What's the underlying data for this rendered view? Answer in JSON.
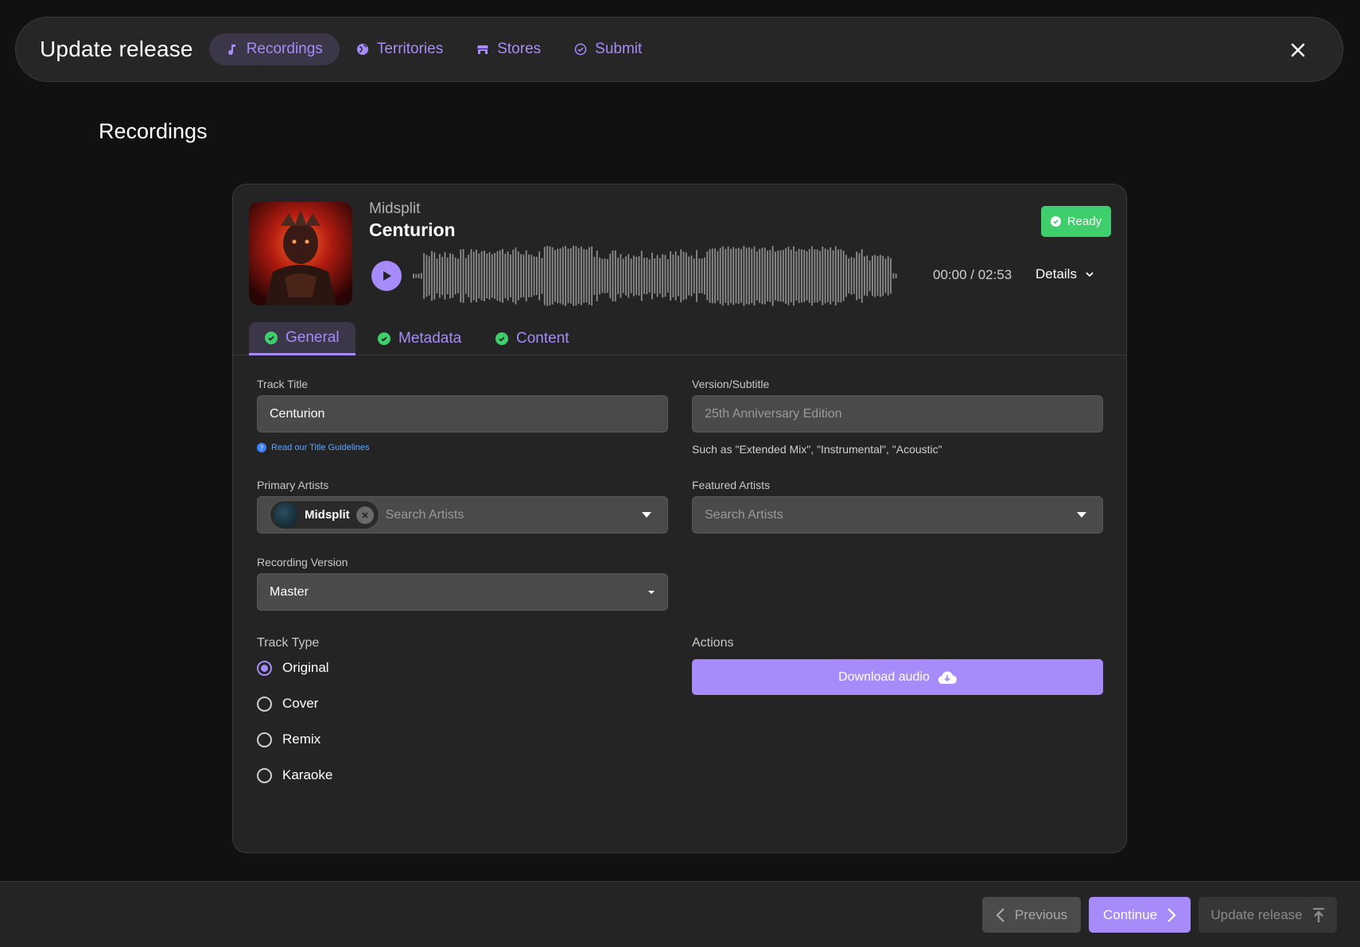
{
  "header": {
    "title": "Update release",
    "tabs": [
      {
        "label": "Recordings",
        "icon": "music-note-icon",
        "active": true
      },
      {
        "label": "Territories",
        "icon": "globe-icon",
        "active": false
      },
      {
        "label": "Stores",
        "icon": "store-icon",
        "active": false
      },
      {
        "label": "Submit",
        "icon": "check-circle-icon",
        "active": false
      }
    ]
  },
  "page_title": "Recordings",
  "recording": {
    "artist": "Midsplit",
    "title": "Centurion",
    "status": "Ready",
    "time": "00:00 / 02:53",
    "details_label": "Details",
    "tabs": [
      {
        "label": "General",
        "active": true
      },
      {
        "label": "Metadata",
        "active": false
      },
      {
        "label": "Content",
        "active": false
      }
    ]
  },
  "form": {
    "track_title_label": "Track Title",
    "track_title_value": "Centurion",
    "guidelines_link": "Read our Title Guidelines",
    "version_label": "Version/Subtitle",
    "version_placeholder": "25th Anniversary Edition",
    "version_helper": "Such as \"Extended Mix\", \"Instrumental\", \"Acoustic\"",
    "primary_artists_label": "Primary Artists",
    "primary_artist_chip": "Midsplit",
    "primary_search_placeholder": "Search Artists",
    "featured_artists_label": "Featured Artists",
    "featured_search_placeholder": "Search Artists",
    "recording_version_label": "Recording Version",
    "recording_version_value": "Master",
    "track_type_label": "Track Type",
    "track_types": [
      {
        "label": "Original",
        "checked": true
      },
      {
        "label": "Cover",
        "checked": false
      },
      {
        "label": "Remix",
        "checked": false
      },
      {
        "label": "Karaoke",
        "checked": false
      }
    ],
    "actions_label": "Actions",
    "download_label": "Download audio"
  },
  "footer": {
    "previous": "Previous",
    "continue": "Continue",
    "update": "Update release"
  },
  "colors": {
    "accent": "#a78bfa",
    "ready": "#3ecf6c",
    "background": "#111111",
    "card": "#242424"
  }
}
